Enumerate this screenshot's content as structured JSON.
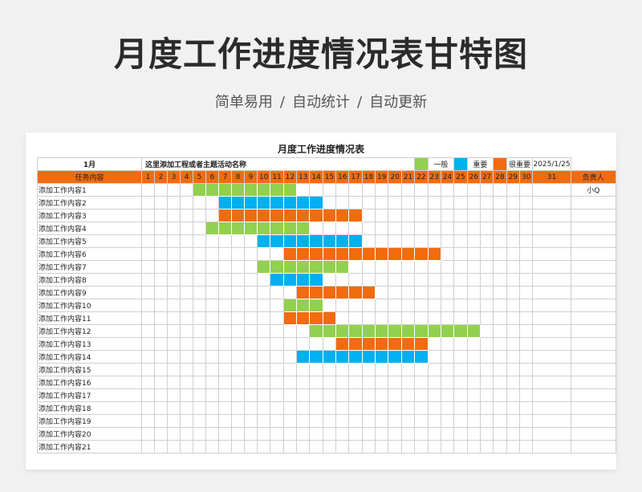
{
  "header": {
    "title": "月度工作进度情况表甘特图",
    "subtitle": [
      "简单易用",
      "自动统计",
      "自动更新"
    ],
    "separator": "/"
  },
  "sheet": {
    "title": "月度工作进度情况表",
    "month": "1月",
    "project": "这里添加工程或者主题活动名称",
    "date": "2025/1/25",
    "legend": [
      {
        "label": "一般",
        "color": "#92d050"
      },
      {
        "label": "重要",
        "color": "#00b0f0"
      },
      {
        "label": "很重要",
        "color": "#f26b0f"
      }
    ],
    "task_header": "任务内容",
    "owner_header": "负责人",
    "days": [
      1,
      2,
      3,
      4,
      5,
      6,
      7,
      8,
      9,
      10,
      11,
      12,
      13,
      14,
      15,
      16,
      17,
      18,
      19,
      20,
      21,
      22,
      23,
      24,
      25,
      26,
      27,
      28,
      29,
      30,
      31
    ],
    "tasks": [
      {
        "name": "添加工作内容1",
        "start": 5,
        "end": 12,
        "level": 0,
        "owner": "小Q"
      },
      {
        "name": "添加工作内容2",
        "start": 7,
        "end": 14,
        "level": 1,
        "owner": ""
      },
      {
        "name": "添加工作内容3",
        "start": 7,
        "end": 17,
        "level": 2,
        "owner": ""
      },
      {
        "name": "添加工作内容4",
        "start": 6,
        "end": 13,
        "level": 0,
        "owner": ""
      },
      {
        "name": "添加工作内容5",
        "start": 10,
        "end": 17,
        "level": 1,
        "owner": ""
      },
      {
        "name": "添加工作内容6",
        "start": 12,
        "end": 23,
        "level": 2,
        "owner": ""
      },
      {
        "name": "添加工作内容7",
        "start": 10,
        "end": 16,
        "level": 0,
        "owner": ""
      },
      {
        "name": "添加工作内容8",
        "start": 11,
        "end": 14,
        "level": 1,
        "owner": ""
      },
      {
        "name": "添加工作内容9",
        "start": 13,
        "end": 18,
        "level": 2,
        "owner": ""
      },
      {
        "name": "添加工作内容10",
        "start": 12,
        "end": 14,
        "level": 0,
        "owner": ""
      },
      {
        "name": "添加工作内容11",
        "start": 12,
        "end": 15,
        "level": 2,
        "owner": ""
      },
      {
        "name": "添加工作内容12",
        "start": 14,
        "end": 26,
        "level": 0,
        "owner": ""
      },
      {
        "name": "添加工作内容13",
        "start": 16,
        "end": 22,
        "level": 2,
        "owner": ""
      },
      {
        "name": "添加工作内容14",
        "start": 13,
        "end": 22,
        "level": 1,
        "owner": ""
      },
      {
        "name": "添加工作内容15",
        "start": 0,
        "end": 0,
        "level": 0,
        "owner": ""
      },
      {
        "name": "添加工作内容16",
        "start": 0,
        "end": 0,
        "level": 0,
        "owner": ""
      },
      {
        "name": "添加工作内容17",
        "start": 0,
        "end": 0,
        "level": 0,
        "owner": ""
      },
      {
        "name": "添加工作内容18",
        "start": 0,
        "end": 0,
        "level": 0,
        "owner": ""
      },
      {
        "name": "添加工作内容19",
        "start": 0,
        "end": 0,
        "level": 0,
        "owner": ""
      },
      {
        "name": "添加工作内容20",
        "start": 0,
        "end": 0,
        "level": 0,
        "owner": ""
      },
      {
        "name": "添加工作内容21",
        "start": 0,
        "end": 0,
        "level": 0,
        "owner": ""
      }
    ]
  }
}
